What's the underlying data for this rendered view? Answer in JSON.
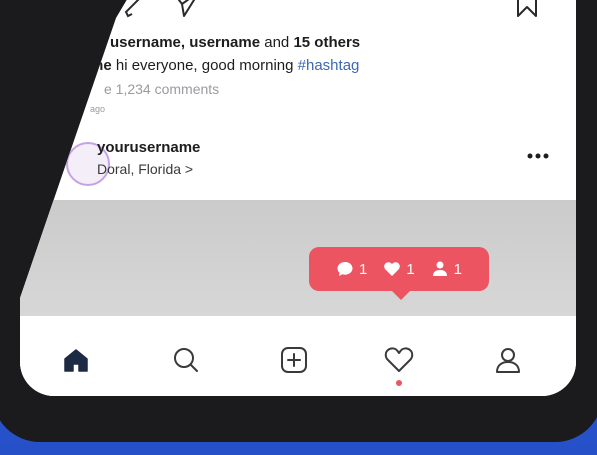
{
  "post": {
    "likes_prefix": "username, username",
    "likes_and": "and",
    "likes_count": "15 others",
    "caption_user": "me",
    "caption_text": "hi everyone, good morning",
    "caption_tag": "#hashtag",
    "view_comments": "e 1,234 comments",
    "time": "ago"
  },
  "post_header": {
    "username": "yourusername",
    "location": "Doral, Florida >",
    "more": "..."
  },
  "notification": {
    "comments": "1",
    "likes": "1",
    "follows": "1",
    "color": "#ec5462"
  },
  "icons": {
    "comment": "comment-icon",
    "send": "send-icon",
    "bookmark": "bookmark-icon",
    "more": "more-icon",
    "home": "home-icon",
    "search": "search-icon",
    "add": "add-icon",
    "activity": "heart-icon",
    "profile": "profile-icon"
  }
}
